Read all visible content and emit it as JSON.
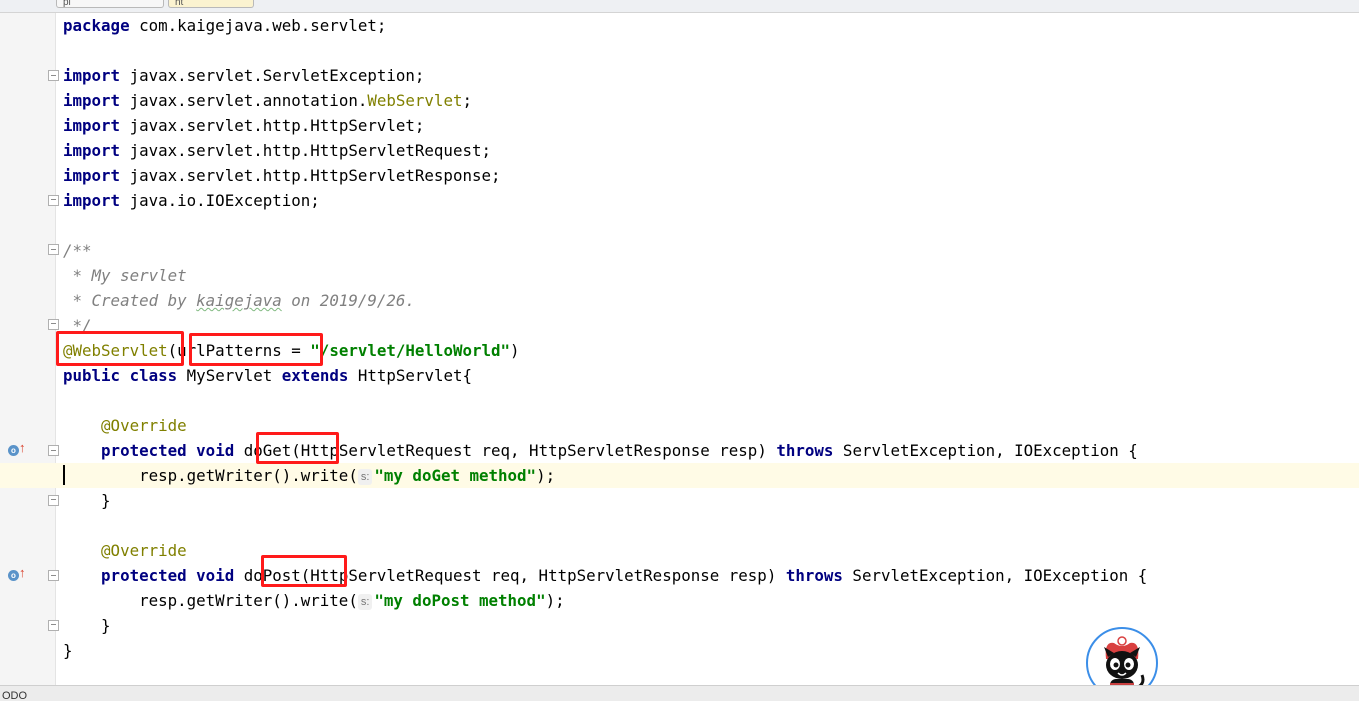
{
  "tabs": [
    {
      "label": "pl"
    },
    {
      "label": "ht"
    }
  ],
  "code": [
    {
      "type": "package",
      "kw": "package",
      "text": " com.kaigejava.web.servlet;"
    },
    {
      "type": "import",
      "kw": "import",
      "text": " javax.servlet.ServletException;"
    },
    {
      "type": "import_ann",
      "kw": "import",
      "pre": " javax.servlet.annotation.",
      "ann": "WebServlet",
      "post": ";"
    },
    {
      "type": "import",
      "kw": "import",
      "text": " javax.servlet.http.HttpServlet;"
    },
    {
      "type": "import",
      "kw": "import",
      "text": " javax.servlet.http.HttpServletRequest;"
    },
    {
      "type": "import",
      "kw": "import",
      "text": " javax.servlet.http.HttpServletResponse;"
    },
    {
      "type": "import",
      "kw": "import",
      "text": " java.io.IOException;"
    },
    {
      "type": "comment",
      "text": "/**"
    },
    {
      "type": "comment",
      "text": " * My servlet"
    },
    {
      "type": "comment_author",
      "pre": " * Created by ",
      "author": "kaigejava",
      "post": " on 2019/9/26."
    },
    {
      "type": "comment",
      "text": " */"
    },
    {
      "type": "annotation",
      "ann": "@WebServlet",
      "mid": "(urlPatterns = ",
      "str": "\"/servlet/HelloWorld\"",
      "post": ")"
    },
    {
      "type": "class",
      "kw1": "public",
      "kw2": "class",
      "name": " MyServlet ",
      "kw3": "extends",
      "post": " HttpServlet{"
    },
    {
      "type": "override",
      "ann": "    @Override"
    },
    {
      "type": "method",
      "indent": "    ",
      "kw1": "protected",
      "kw2": "void",
      "name": " doGet",
      "params": "(HttpServletRequest req, HttpServletResponse resp) ",
      "kw3": "throws",
      "post": " ServletException, IOException {"
    },
    {
      "type": "call",
      "pre": "        resp.getWriter().write(",
      "hint": "s:",
      "str": "\"my doGet method\"",
      "post": ");"
    },
    {
      "type": "plain",
      "text": "    }"
    },
    {
      "type": "override",
      "ann": "    @Override"
    },
    {
      "type": "method",
      "indent": "    ",
      "kw1": "protected",
      "kw2": "void",
      "name": " doPost",
      "params": "(HttpServletRequest req, HttpServletResponse resp) ",
      "kw3": "throws",
      "post": " ServletException, IOException {"
    },
    {
      "type": "call",
      "pre": "        resp.getWriter().write(",
      "hint": "s:",
      "str": "\"my doPost method\"",
      "post": ");"
    },
    {
      "type": "plain",
      "text": "    }"
    },
    {
      "type": "plain",
      "text": "}"
    }
  ],
  "gutter": {
    "override_icon": "override-method-icon",
    "override_letter": "o",
    "override_arrow": "↑"
  },
  "status": {
    "text": "ODO"
  },
  "colors": {
    "keyword": "#000080",
    "annotation": "#808000",
    "string": "#008000",
    "comment": "#808080",
    "highlight_box": "#ff1a1a",
    "caret_line": "#fffbe6"
  }
}
